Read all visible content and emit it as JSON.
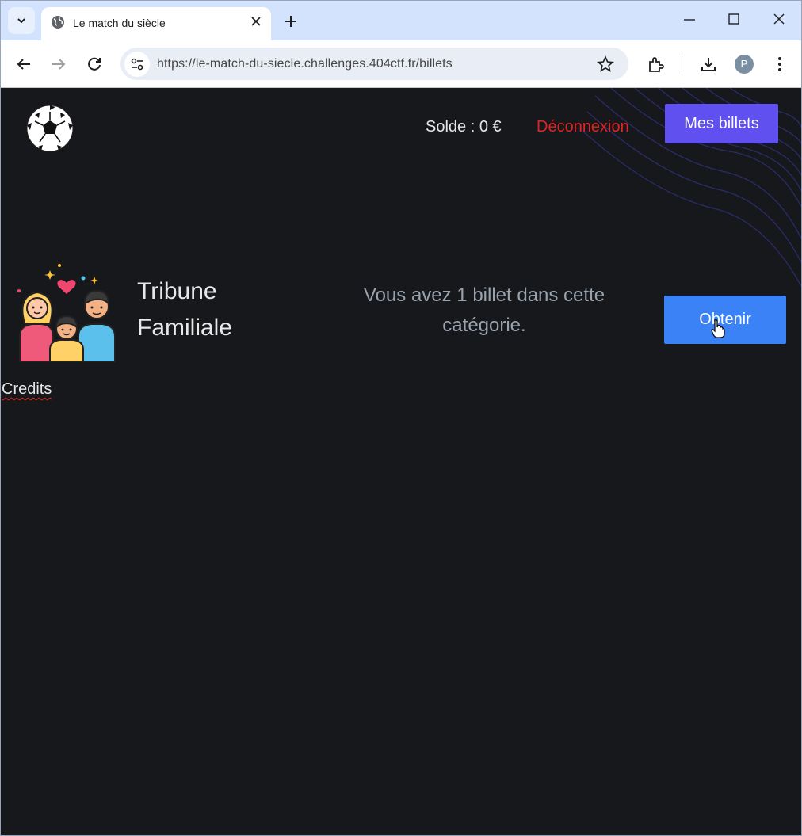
{
  "browser": {
    "tab_title": "Le match du siècle",
    "url": "https://le-match-du-siecle.challenges.404ctf.fr/billets",
    "profile_initial": "P"
  },
  "header": {
    "balance": "Solde : 0 €",
    "logout_label": "Déconnexion",
    "my_tickets_label": "Mes billets"
  },
  "category": {
    "name": "Tribune Familiale",
    "message": "Vous avez 1 billet dans cette catégorie.",
    "obtain_label": "Obtenir"
  },
  "footer": {
    "credits_label": "Credits"
  },
  "colors": {
    "page_bg": "#17181b",
    "primary_button": "#6050f0",
    "obtain_button": "#3b82f6",
    "logout": "#e02424"
  }
}
